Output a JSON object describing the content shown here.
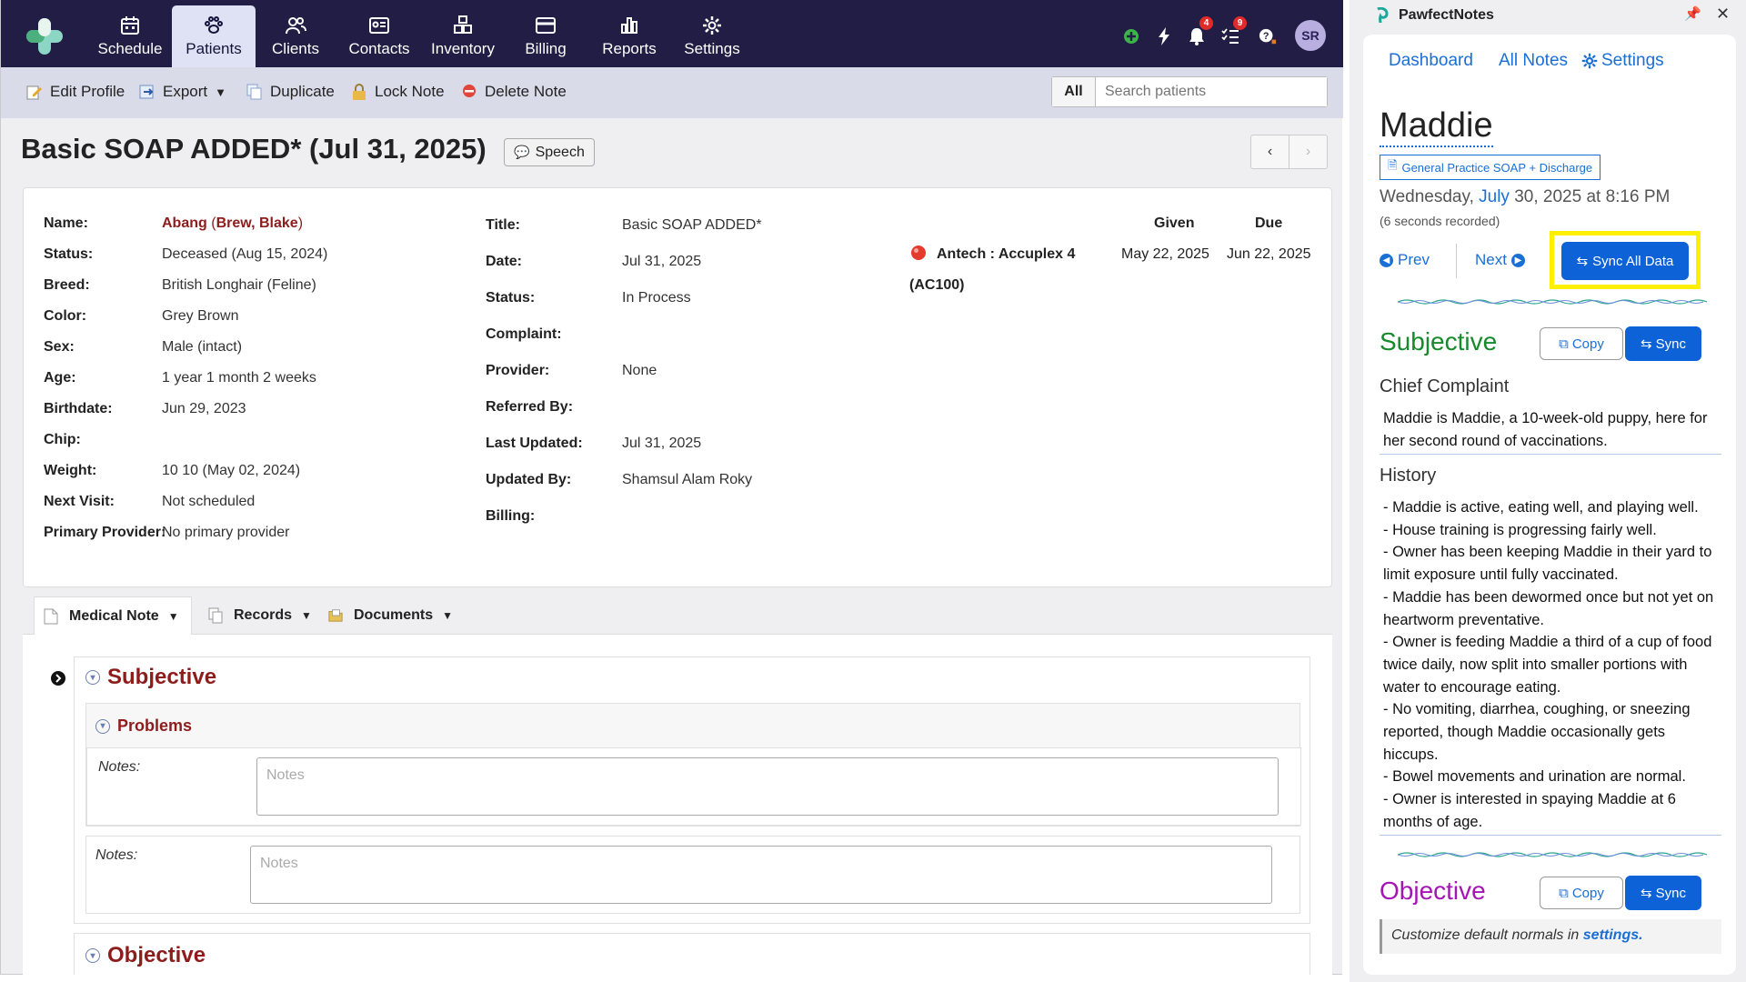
{
  "nav": {
    "items": [
      {
        "label": "Schedule",
        "icon": "calendar-icon"
      },
      {
        "label": "Patients",
        "icon": "paw-icon",
        "active": true
      },
      {
        "label": "Clients",
        "icon": "people-icon"
      },
      {
        "label": "Contacts",
        "icon": "contact-card-icon"
      },
      {
        "label": "Inventory",
        "icon": "boxes-icon"
      },
      {
        "label": "Billing",
        "icon": "credit-card-icon"
      },
      {
        "label": "Reports",
        "icon": "bar-chart-icon"
      },
      {
        "label": "Settings",
        "icon": "gear-icon"
      }
    ],
    "notifications_count": "4",
    "tasks_count": "9",
    "avatar_initials": "SR"
  },
  "toolbar": {
    "edit_profile": "Edit Profile",
    "export": "Export",
    "duplicate": "Duplicate",
    "lock_note": "Lock Note",
    "delete_note": "Delete Note",
    "search_scope": "All",
    "search_placeholder": "Search patients"
  },
  "page": {
    "title": "Basic SOAP ADDED* (Jul 31, 2025)",
    "speech_label": "Speech"
  },
  "patient": {
    "name_label": "Name:",
    "name": "Abang",
    "name_owner_open": " (",
    "owner": "Brew, Blake",
    "name_owner_close": ")",
    "status_label": "Status:",
    "status": "Deceased (Aug 15, 2024)",
    "breed_label": "Breed:",
    "breed": "British Longhair (Feline)",
    "color_label": "Color:",
    "color": "Grey Brown",
    "sex_label": "Sex:",
    "sex": "Male (intact)",
    "age_label": "Age:",
    "age": "1 year 1 month 2 weeks",
    "birthdate_label": "Birthdate:",
    "birthdate": "Jun 29, 2023",
    "chip_label": "Chip:",
    "chip": "",
    "weight_label": "Weight:",
    "weight": "10 10 (May 02, 2024)",
    "next_visit_label": "Next Visit:",
    "next_visit": "Not scheduled",
    "primary_provider_label": "Primary Provider:",
    "primary_provider": "No primary provider"
  },
  "note": {
    "title_label": "Title:",
    "title": "Basic SOAP ADDED*",
    "date_label": "Date:",
    "date": "Jul 31, 2025",
    "status_label": "Status:",
    "status": "In Process",
    "complaint_label": "Complaint:",
    "complaint": "",
    "provider_label": "Provider:",
    "provider": "None",
    "referred_by_label": "Referred By:",
    "referred_by": "",
    "last_updated_label": "Last Updated:",
    "last_updated": "Jul 31, 2025",
    "updated_by_label": "Updated By:",
    "updated_by": "Shamsul Alam Roky",
    "billing_label": "Billing:",
    "billing": ""
  },
  "reminders": {
    "given_header": "Given",
    "due_header": "Due",
    "item_name": "Antech : Accuplex 4",
    "item_code": "(AC100)",
    "given": "May 22, 2025",
    "due": "Jun 22, 2025",
    "status_color": "#e53b2c"
  },
  "tabs": [
    {
      "label": "Medical Note"
    },
    {
      "label": "Records"
    },
    {
      "label": "Documents"
    }
  ],
  "soap": {
    "subjective": "Subjective",
    "problems": "Problems",
    "notes_label": "Notes:",
    "notes_placeholder": "Notes",
    "objective": "Objective"
  },
  "panel": {
    "app_name": "PawfectNotes",
    "links": {
      "dashboard": "Dashboard",
      "all_notes": "All Notes",
      "settings": "Settings"
    },
    "patient_name": "Maddie",
    "template": "General Practice SOAP + Discharge",
    "date_prefix": "Wednesday, ",
    "date_month": "July",
    "date_suffix": " 30, 2025 at 8:16 PM",
    "recorded": "(6 seconds recorded)",
    "prev": "Prev",
    "next": "Next",
    "sync_all": "Sync All Data",
    "subjective_title": "Subjective",
    "copy": "Copy",
    "sync": "Sync",
    "chief_complaint_title": "Chief Complaint",
    "chief_complaint": "Maddie is Maddie, a 10-week-old puppy, here for her second round of vaccinations.",
    "history_title": "History",
    "history": [
      "- Maddie is active, eating well, and playing well.",
      "- House training is progressing fairly well.",
      "- Owner has been keeping Maddie in their yard to limit exposure until fully vaccinated.",
      "- Maddie has been dewormed once but not yet on heartworm preventative.",
      "- Owner is feeding Maddie a third of a cup of food twice daily, now split into smaller portions with water to encourage eating.",
      "- No vomiting, diarrhea, coughing, or sneezing reported, though Maddie occasionally gets hiccups.",
      "- Bowel movements and urination are normal.",
      "- Owner is interested in spaying Maddie at 6 months of age."
    ],
    "objective_title": "Objective",
    "normals_note": "Customize default normals in ",
    "normals_link": "settings.",
    "colors": {
      "subjective": "#178a2c",
      "objective": "#a515b5",
      "accent": "#0d62d8",
      "highlight": "#ffef00"
    }
  }
}
